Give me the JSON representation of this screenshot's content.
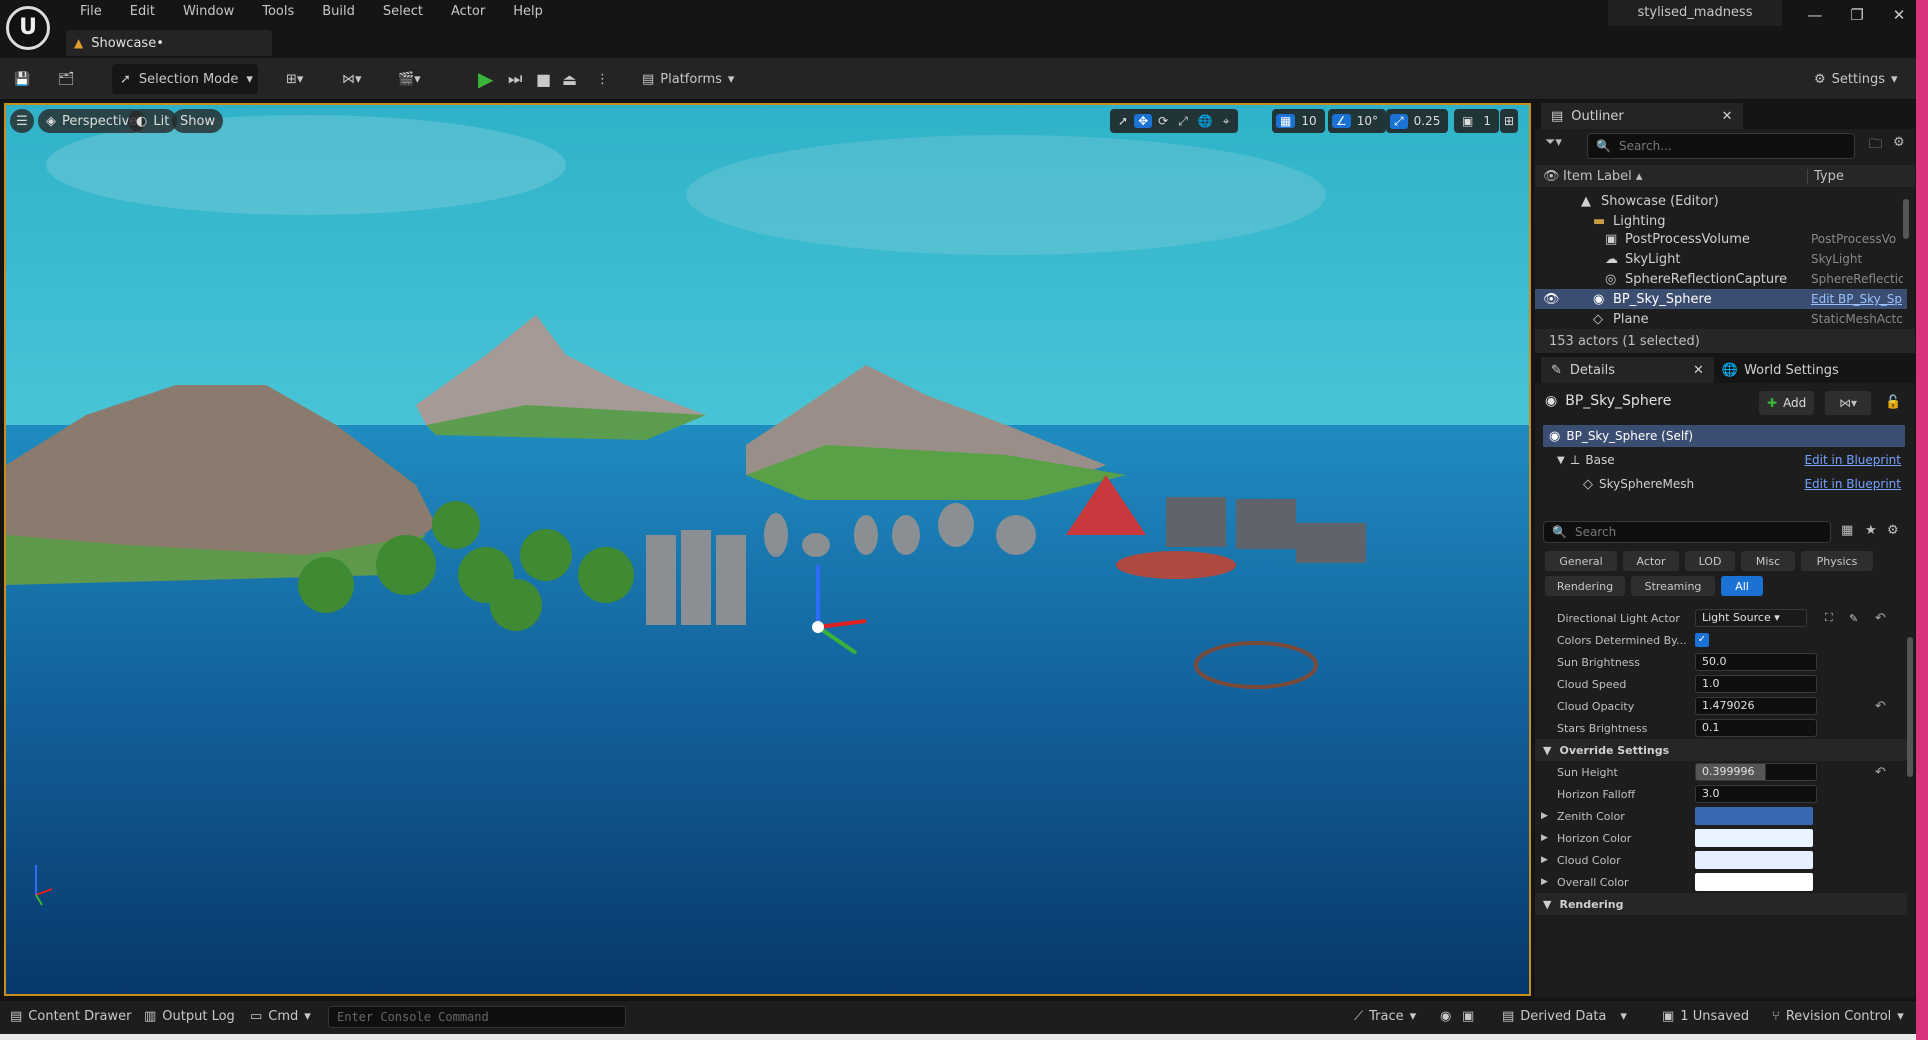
{
  "menu": {
    "items": [
      "File",
      "Edit",
      "Window",
      "Tools",
      "Build",
      "Select",
      "Actor",
      "Help"
    ]
  },
  "tab": {
    "label": "Showcase•"
  },
  "project_name": "stylised_madness",
  "toolbar": {
    "selection_mode": "Selection Mode",
    "platforms": "Platforms",
    "settings": "Settings"
  },
  "viewport": {
    "perspective": "Perspective",
    "lit": "Lit",
    "show": "Show",
    "grid_snap": "10",
    "rot_snap": "10°",
    "scale_snap": "0.25",
    "camera_speed": "1"
  },
  "outliner": {
    "title": "Outliner",
    "search_placeholder": "Search...",
    "col_label": "Item Label ▴",
    "col_type": "Type",
    "rows": [
      {
        "label": "Showcase (Editor)",
        "type": ""
      },
      {
        "label": "Lighting",
        "type": ""
      },
      {
        "label": "PostProcessVolume",
        "type": "PostProcessVo"
      },
      {
        "label": "SkyLight",
        "type": "SkyLight"
      },
      {
        "label": "SphereReflectionCapture",
        "type": "SphereReflectic"
      },
      {
        "label": "BP_Sky_Sphere",
        "type": "Edit BP_Sky_Sp"
      },
      {
        "label": "Plane",
        "type": "StaticMeshActc"
      }
    ],
    "status": "153 actors (1 selected)"
  },
  "details": {
    "tab": "Details",
    "world_tab": "World Settings",
    "actor_name": "BP_Sky_Sphere",
    "add_label": "Add",
    "components": [
      {
        "label": "BP_Sky_Sphere (Self)",
        "link": ""
      },
      {
        "label": "Base",
        "link": "Edit in Blueprint"
      },
      {
        "label": "SkySphereMesh",
        "link": "Edit in Blueprint"
      }
    ],
    "search_placeholder": "Search",
    "categories_row1": [
      "General",
      "Actor",
      "LOD",
      "Misc",
      "Physics"
    ],
    "categories_row2": [
      "Rendering",
      "Streaming",
      "All"
    ],
    "props": [
      {
        "label": "Directional Light Actor",
        "value": "Light Source ▾"
      },
      {
        "label": "Colors Determined By...",
        "value": "✓"
      },
      {
        "label": "Sun Brightness",
        "value": "50.0"
      },
      {
        "label": "Cloud Speed",
        "value": "1.0"
      },
      {
        "label": "Cloud Opacity",
        "value": "1.479026"
      },
      {
        "label": "Stars Brightness",
        "value": "0.1"
      }
    ],
    "override_section": "Override Settings",
    "override_props": [
      {
        "label": "Sun Height",
        "value": "0.399996"
      },
      {
        "label": "Horizon Falloff",
        "value": "3.0"
      }
    ],
    "color_props": [
      {
        "label": "Zenith Color",
        "color": "#3a68b0"
      },
      {
        "label": "Horizon Color",
        "color": "#e8f4ff"
      },
      {
        "label": "Cloud Color",
        "color": "#e4f0ff"
      },
      {
        "label": "Overall Color",
        "color": "#ffffff"
      }
    ],
    "rendering_section": "Rendering"
  },
  "statusbar": {
    "content_drawer": "Content Drawer",
    "output_log": "Output Log",
    "cmd": "Cmd",
    "console_placeholder": "Enter Console Command",
    "trace": "Trace",
    "derived_data": "Derived Data",
    "unsaved": "1 Unsaved",
    "revision_control": "Revision Control"
  }
}
